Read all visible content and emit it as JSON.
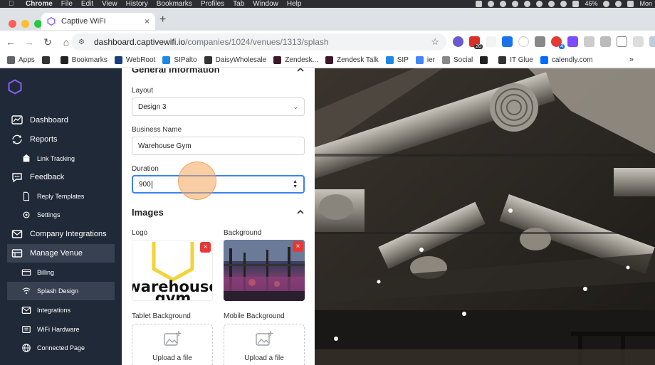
{
  "menubar": {
    "app": "Chrome",
    "items": [
      "File",
      "Edit",
      "View",
      "History",
      "Bookmarks",
      "Profiles",
      "Tab",
      "Window",
      "Help"
    ],
    "battery": "46%",
    "clock": "Mon"
  },
  "tab": {
    "title": "Captive WiFi",
    "close": "×"
  },
  "newtab": "+",
  "omnibox": {
    "host": "dashboard.captivewifi.io",
    "path": "/companies/1024/venues/1313/splash"
  },
  "extensions": {
    "badge_a": "20",
    "badge_b": "4"
  },
  "bookmarks": [
    {
      "label": "Apps",
      "color": "#5f6368"
    },
    {
      "label": "",
      "color": "#333333"
    },
    {
      "label": "Bookmarks",
      "color": "#222222"
    },
    {
      "label": "WebRoot",
      "color": "#1a3e7a"
    },
    {
      "label": "SIPalto",
      "color": "#1e88e5"
    },
    {
      "label": "DaisyWholesale",
      "color": "#333333"
    },
    {
      "label": "Zendesk...",
      "color": "#3a1a2a"
    },
    {
      "label": "Zendesk Talk",
      "color": "#3a1a2a"
    },
    {
      "label": "SIP",
      "color": "#1e88e5"
    },
    {
      "label": "ier",
      "color": "#4285f4"
    },
    {
      "label": "Social",
      "color": "#888888"
    },
    {
      "label": "",
      "color": "#222222"
    },
    {
      "label": "IT Glue",
      "color": "#333333"
    },
    {
      "label": "calendly.com",
      "color": "#006bff"
    }
  ],
  "bookmarks_more": "»",
  "sidebar": {
    "items": [
      {
        "label": "Dashboard",
        "level": "top",
        "icon": "dashboard-icon"
      },
      {
        "label": "Reports",
        "level": "top",
        "icon": "reports-icon"
      },
      {
        "label": "Link Tracking",
        "level": "sub",
        "icon": "link-tracking-icon"
      },
      {
        "label": "Feedback",
        "level": "top",
        "icon": "feedback-icon"
      },
      {
        "label": "Reply Templates",
        "level": "sub",
        "icon": "document-icon"
      },
      {
        "label": "Settings",
        "level": "sub",
        "icon": "gear-icon"
      },
      {
        "label": "Company Integrations",
        "level": "top",
        "icon": "mail-icon"
      },
      {
        "label": "Manage Venue",
        "level": "top",
        "icon": "venue-icon",
        "active": true
      },
      {
        "label": "Billing",
        "level": "sub",
        "icon": "billing-icon"
      },
      {
        "label": "Splash Design",
        "level": "sub",
        "icon": "wifi-icon",
        "active": true
      },
      {
        "label": "Integrations",
        "level": "sub",
        "icon": "mail-icon"
      },
      {
        "label": "WiFi Hardware",
        "level": "sub",
        "icon": "hardware-icon"
      },
      {
        "label": "Connected Page",
        "level": "sub",
        "icon": "globe-icon"
      }
    ]
  },
  "form": {
    "general_title": "General Information",
    "layout": {
      "label": "Layout",
      "value": "Design 3"
    },
    "business_name": {
      "label": "Business Name",
      "value": "Warehouse Gym"
    },
    "duration": {
      "label": "Duration",
      "value": "900"
    },
    "images_title": "Images",
    "logo_label": "Logo",
    "background_label": "Background",
    "logo_text_line1": "warehouse",
    "logo_text_line2": "gym",
    "tablet_bg_label": "Tablet Background",
    "mobile_bg_label": "Mobile Background",
    "upload_text": "Upload a file",
    "delete": "×"
  },
  "colors": {
    "sidebar_bg": "#1f2937",
    "sidebar_active": "#374151",
    "accent_blue": "#3b82f6",
    "logo_purple": "#8b5cf6",
    "delete_red": "#e53935",
    "logo_yellow": "#f2d43a"
  }
}
